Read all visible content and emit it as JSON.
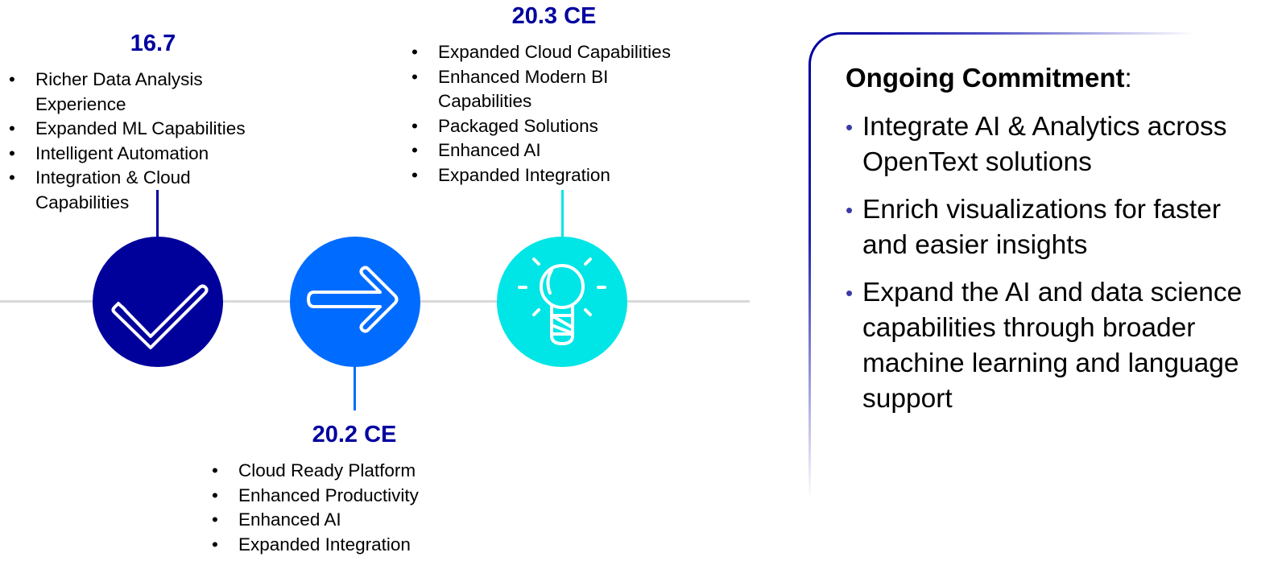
{
  "colors": {
    "version_heading": "#0000a0",
    "circle_1": "#00009b",
    "circle_2": "#006cff",
    "circle_3": "#00e5e5",
    "timeline": "#d9d9d9",
    "panel_border": "#0000a0"
  },
  "milestones": [
    {
      "version": "16.7",
      "icon": "checkmark-icon",
      "items": [
        "Richer Data Analysis Experience",
        "Expanded ML Capabilities",
        "Intelligent Automation",
        "Integration & Cloud Capabilities"
      ]
    },
    {
      "version": "20.2 CE",
      "icon": "arrow-right-icon",
      "items": [
        "Cloud Ready Platform",
        "Enhanced Productivity",
        "Enhanced AI",
        "Expanded Integration"
      ]
    },
    {
      "version": "20.3 CE",
      "icon": "lightbulb-icon",
      "items": [
        "Expanded Cloud Capabilities",
        "Enhanced Modern BI Capabilities",
        "Packaged Solutions",
        "Enhanced AI",
        "Expanded Integration"
      ]
    }
  ],
  "commitment": {
    "title_bold": "Ongoing Commitment",
    "title_suffix": ":",
    "items": [
      "Integrate AI & Analytics across OpenText solutions",
      "Enrich visualizations for faster and easier insights",
      "Expand the AI and data science capabilities through broader machine learning and language support"
    ]
  }
}
